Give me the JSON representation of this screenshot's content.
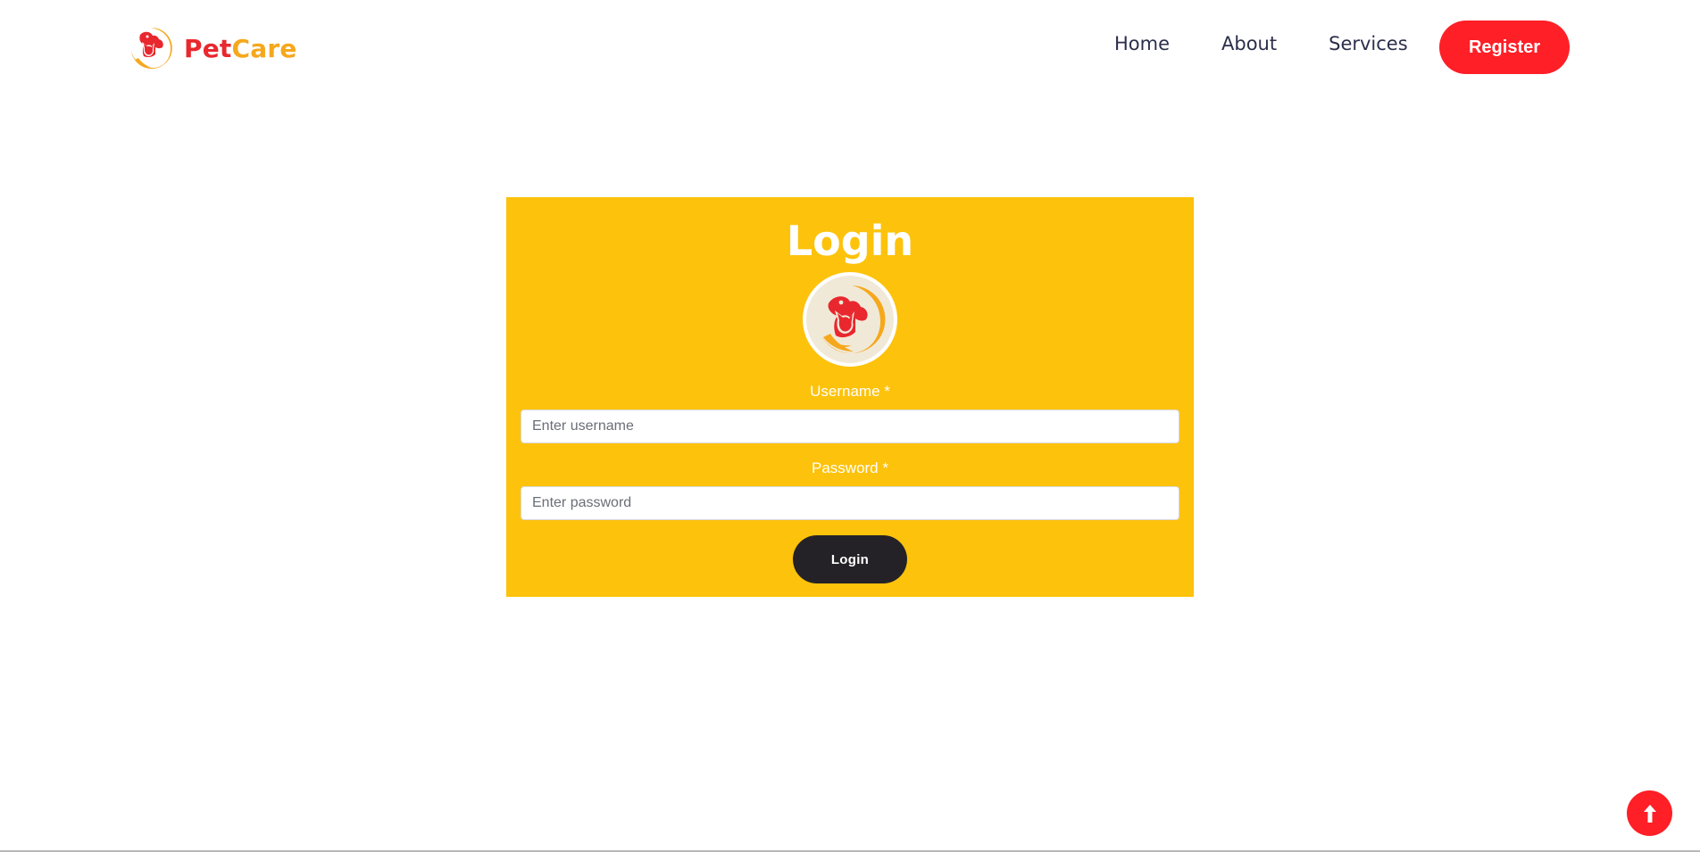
{
  "brand": {
    "name_part1": "Pet",
    "name_part2": "Care",
    "logo_icon": "pet-hand-logo-icon"
  },
  "nav": {
    "items": [
      {
        "label": "Home"
      },
      {
        "label": "About"
      },
      {
        "label": "Services"
      }
    ],
    "register_label": "Register"
  },
  "login": {
    "title": "Login",
    "username_label": "Username *",
    "username_placeholder": "Enter username",
    "username_value": "",
    "password_label": "Password *",
    "password_placeholder": "Enter password",
    "password_value": "",
    "submit_label": "Login"
  },
  "scroll_top": {
    "icon": "arrow-up-icon"
  },
  "colors": {
    "brand_red": "#ff1f27",
    "brand_orange": "#f5a81c",
    "card_yellow": "#fdc20b",
    "button_dark": "#242227",
    "nav_text": "#2b2f4a"
  }
}
